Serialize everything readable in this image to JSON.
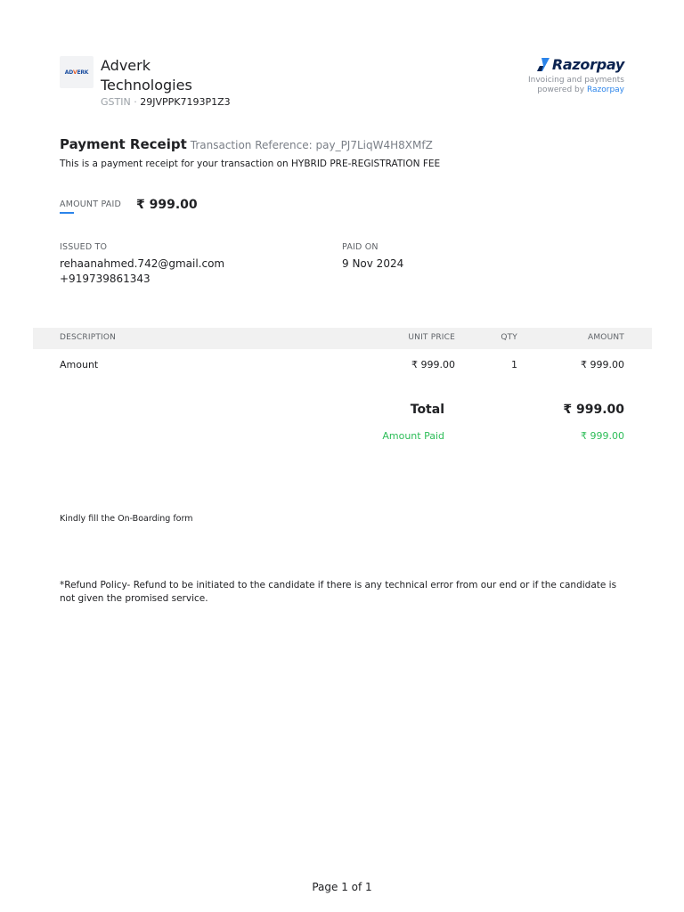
{
  "merchant": {
    "logo_text_a": "AD",
    "logo_text_b": "V",
    "logo_text_c": "ERK",
    "name": "Adverk Technologies",
    "gstin_label": "GSTIN",
    "gstin_sep": " · ",
    "gstin_value": "29JVPPK7193P1Z3"
  },
  "provider": {
    "brand": "Razorpay",
    "tagline_line1": "Invoicing and payments",
    "tagline_line2_prefix": "powered by ",
    "tagline_line2_link": "Razorpay",
    "brand_color": "#0c2451",
    "accent_color": "#2b84ea"
  },
  "receipt": {
    "title": "Payment Receipt",
    "transaction_reference": "Transaction Reference: pay_PJ7LiqW4H8XMfZ",
    "subtitle": "This is a payment receipt for your transaction on HYBRID PRE-REGISTRATION FEE",
    "amount_paid_label": "AMOUNT PAID",
    "amount_paid_value": "₹ 999.00"
  },
  "issued_to": {
    "label": "ISSUED TO",
    "email": "rehaanahmed.742@gmail.com",
    "phone": "+919739861343"
  },
  "paid_on": {
    "label": "PAID ON",
    "date": "9 Nov 2024"
  },
  "table": {
    "headers": {
      "description": "DESCRIPTION",
      "unit_price": "UNIT PRICE",
      "qty": "QTY",
      "amount": "AMOUNT"
    },
    "rows": [
      {
        "description": "Amount",
        "unit_price": "₹ 999.00",
        "qty": "1",
        "amount": "₹ 999.00"
      }
    ]
  },
  "totals": {
    "total_label": "Total",
    "total_value": "₹ 999.00",
    "amount_paid_label": "Amount Paid",
    "amount_paid_value": "₹ 999.00",
    "paid_color": "#2ebd59"
  },
  "notes": {
    "onboarding": "Kindly fill the On-Boarding form",
    "refund_policy": "*Refund Policy- Refund to be initiated to the candidate if there is any technical error from our end or if the candidate is not given the promised service."
  },
  "footer": {
    "page": "Page 1 of 1"
  }
}
